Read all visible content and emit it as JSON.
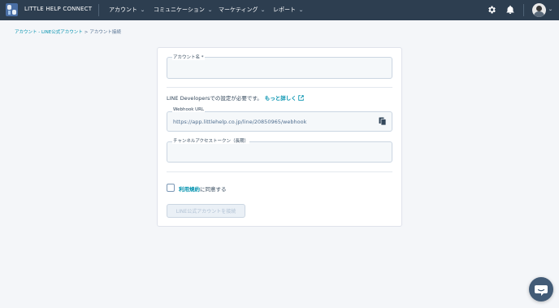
{
  "header": {
    "brand": "LITTLE HELP CONNECT",
    "nav": [
      {
        "label": "アカウント"
      },
      {
        "label": "コミュニケーション"
      },
      {
        "label": "マーケティング"
      },
      {
        "label": "レポート"
      }
    ],
    "icons": [
      "settings-gear-icon",
      "bell-icon",
      "avatar"
    ]
  },
  "breadcrumb": {
    "link": "アカウント - LINE公式アカウント",
    "separator": ">",
    "current": "アカウント接続"
  },
  "form": {
    "account_name_label": "アカウント名 *",
    "account_name_value": "",
    "note_text": "LINE Developersでの設定が必要です。",
    "note_link": "もっと詳しく",
    "webhook_label": "Webhook URL",
    "webhook_value": "https://app.littlehelp.co.jp/line/20850965/webhook",
    "token_label": "チャンネルアクセストークン（長期）",
    "token_value": "",
    "terms_link": "利用規約",
    "terms_suffix": "に同意する",
    "terms_checked": false,
    "submit_label": "LINE公式アカウントを接続"
  },
  "colors": {
    "topbar": "#2d3e50",
    "accent_link": "#0091ae",
    "chat_bubble": "#425b76"
  }
}
